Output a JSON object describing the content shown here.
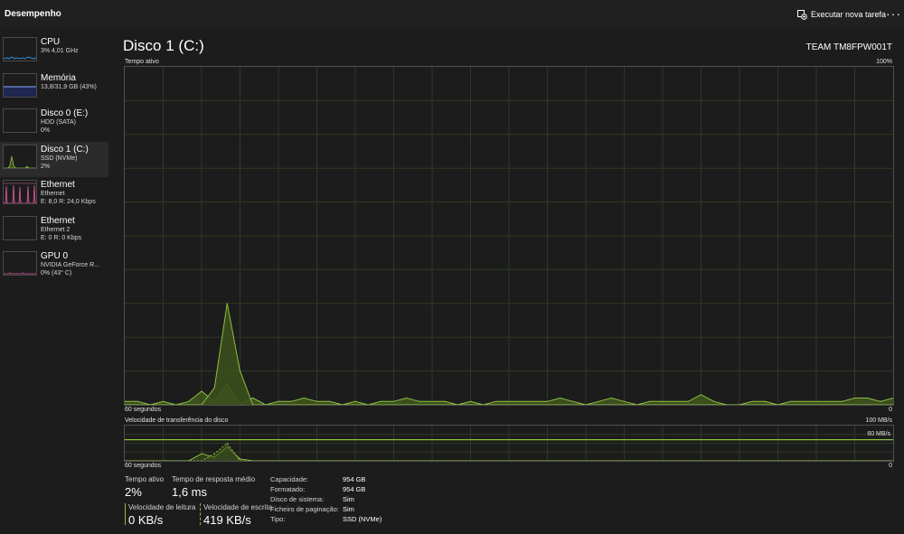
{
  "header": {
    "title": "Desempenho",
    "run_task_label": "Executar nova tarefa",
    "more_label": "···"
  },
  "sidebar": {
    "items": [
      {
        "name": "CPU",
        "line1": "3% 4,01 GHz",
        "line2": ""
      },
      {
        "name": "Memória",
        "line1": "13,8/31,9 GB (43%)",
        "line2": ""
      },
      {
        "name": "Disco 0 (E:)",
        "line1": "HDD (SATA)",
        "line2": "0%"
      },
      {
        "name": "Disco 1 (C:)",
        "line1": "SSD (NVMe)",
        "line2": "2%"
      },
      {
        "name": "Ethernet",
        "line1": "Ethernet",
        "line2": "E: 8,0 R: 24,0 Kbps"
      },
      {
        "name": "Ethernet",
        "line1": "Ethernet 2",
        "line2": "E: 0 R: 0 Kbps"
      },
      {
        "name": "GPU 0",
        "line1": "NVIDIA GeForce R...",
        "line2": "0% (43° C)"
      }
    ],
    "selected_index": 3
  },
  "main": {
    "title": "Disco 1 (C:)",
    "model": "TEAM TM8FPW001T",
    "active_chart": {
      "label": "Tempo ativo",
      "max_label": "100%",
      "time_label": "60 segundos",
      "zero_label": "0"
    },
    "transfer_chart": {
      "label": "Velocidade de transferência do disco",
      "max_label": "100 MB/s",
      "mid_label": "60 MB/s",
      "time_label": "60 segundos",
      "zero_label": "0"
    },
    "stats": {
      "active_time_label": "Tempo ativo",
      "active_time_value": "2%",
      "response_label": "Tempo de resposta médio",
      "response_value": "1,6 ms",
      "read_label": "Velocidade de leitura",
      "read_value": "0 KB/s",
      "write_label": "Velocidade de escrita",
      "write_value": "419 KB/s"
    },
    "properties": [
      {
        "key": "Capacidade:",
        "value": "954 GB"
      },
      {
        "key": "Formatado:",
        "value": "954 GB"
      },
      {
        "key": "Disco de sistema:",
        "value": "Sim"
      },
      {
        "key": "Ficheiro de paginação:",
        "value": "Sim"
      },
      {
        "key": "Tipo:",
        "value": "SSD (NVMe)"
      }
    ]
  },
  "colors": {
    "disk_accent": "#8cbf3f",
    "disk_fill": "#3b4f1d",
    "cpu_accent": "#2f8fd8",
    "memory_accent": "#8ea7ff",
    "ethernet_accent": "#d85a9a",
    "grid": "#2d3a22"
  },
  "chart_data": [
    {
      "type": "area",
      "title": "Tempo ativo",
      "xlabel": "60 segundos",
      "ylim": [
        0,
        100
      ],
      "x": [
        60,
        59,
        58,
        57,
        56,
        55,
        54,
        53,
        52,
        51,
        50,
        49,
        48,
        47,
        46,
        45,
        44,
        43,
        42,
        41,
        40,
        39,
        38,
        37,
        36,
        35,
        34,
        33,
        32,
        31,
        30,
        29,
        28,
        27,
        26,
        25,
        24,
        23,
        22,
        21,
        20,
        19,
        18,
        17,
        16,
        15,
        14,
        13,
        12,
        11,
        10,
        9,
        8,
        7,
        6,
        5,
        4,
        3,
        2,
        1,
        0
      ],
      "series": [
        {
          "values": [
            1,
            1,
            0,
            1,
            0,
            1,
            4,
            1,
            6,
            0,
            2,
            0,
            1,
            1,
            2,
            1,
            1,
            0,
            1,
            0,
            1,
            1,
            2,
            1,
            1,
            1,
            0,
            1,
            0,
            1,
            1,
            1,
            1,
            1,
            2,
            1,
            0,
            1,
            2,
            1,
            0,
            1,
            1,
            1,
            1,
            3,
            1,
            0,
            0,
            1,
            1,
            0,
            1,
            1,
            1,
            1,
            1,
            2,
            2,
            1,
            2
          ]
        },
        {
          "values": [
            0,
            0,
            0,
            0,
            0,
            0,
            0,
            5,
            30,
            10,
            0,
            0,
            0,
            0,
            0,
            0,
            0,
            0,
            0,
            0,
            0,
            0,
            0,
            0,
            0,
            0,
            0,
            0,
            0,
            0,
            0,
            0,
            0,
            0,
            0,
            0,
            0,
            0,
            0,
            0,
            0,
            0,
            0,
            0,
            0,
            0,
            0,
            0,
            0,
            0,
            0,
            0,
            0,
            0,
            0,
            0,
            0,
            0,
            0,
            0,
            0
          ]
        }
      ]
    },
    {
      "type": "area",
      "title": "Velocidade de transferência do disco",
      "xlabel": "60 segundos",
      "ylim": [
        0,
        100
      ],
      "y_unit": "MB/s",
      "reference_line": 60,
      "x": [
        60,
        59,
        58,
        57,
        56,
        55,
        54,
        53,
        52,
        51,
        50,
        49,
        48,
        47,
        46,
        45,
        44,
        43,
        42,
        41,
        40,
        39,
        38,
        37,
        36,
        35,
        34,
        33,
        32,
        31,
        30,
        29,
        28,
        27,
        26,
        25,
        24,
        23,
        22,
        21,
        20,
        19,
        18,
        17,
        16,
        15,
        14,
        13,
        12,
        11,
        10,
        9,
        8,
        7,
        6,
        5,
        4,
        3,
        2,
        1,
        0
      ],
      "series": [
        {
          "values": [
            0,
            0,
            0,
            0,
            0,
            0,
            20,
            10,
            40,
            5,
            0,
            0,
            0,
            0,
            0,
            0,
            0,
            0,
            0,
            0,
            0,
            0,
            0,
            0,
            0,
            0,
            0,
            0,
            0,
            0,
            0,
            0,
            0,
            0,
            0,
            0,
            0,
            0,
            0,
            0,
            0,
            0,
            0,
            0,
            0,
            0,
            0,
            0,
            0,
            0,
            0,
            0,
            0,
            0,
            0,
            0,
            0,
            0,
            0,
            0,
            0
          ]
        },
        {
          "values": [
            0,
            0,
            0,
            0,
            0,
            0,
            0,
            20,
            50,
            0,
            0,
            0,
            0,
            0,
            0,
            0,
            0,
            0,
            0,
            0,
            0,
            0,
            0,
            0,
            0,
            0,
            0,
            0,
            0,
            0,
            0,
            0,
            0,
            0,
            0,
            0,
            0,
            0,
            0,
            0,
            0,
            0,
            0,
            0,
            0,
            0,
            0,
            0,
            0,
            0,
            0,
            0,
            0,
            0,
            0,
            0,
            0,
            0,
            0,
            0,
            0
          ]
        }
      ]
    }
  ]
}
